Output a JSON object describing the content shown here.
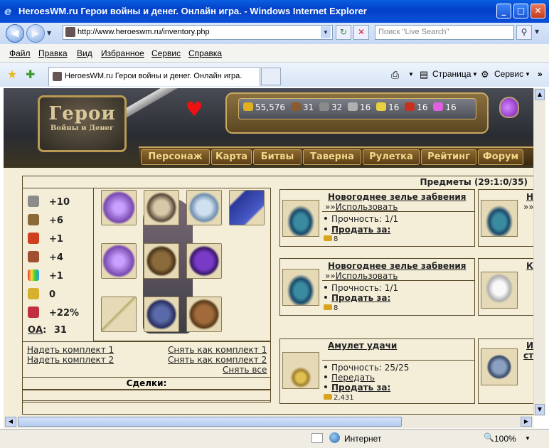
{
  "window": {
    "title": "HeroesWM.ru Герои войны и денег. Онлайн игра. - Windows Internet Explorer"
  },
  "browser": {
    "url": "http://www.heroeswm.ru/inventory.php",
    "search_placeholder": "Поиск \"Live Search\"",
    "menu": [
      "Файл",
      "Правка",
      "Вид",
      "Избранное",
      "Сервис",
      "Справка"
    ],
    "tab_title": "HeroesWM.ru Герои войны и денег. Онлайн игра.",
    "tools": {
      "page": "Страница",
      "service": "Сервис"
    },
    "status": {
      "zone": "Интернет",
      "zoom": "100%"
    }
  },
  "game": {
    "logo": {
      "title": "Герои",
      "subtitle": "Войны и Денег"
    },
    "resources": [
      {
        "name": "gold",
        "value": "55,576",
        "color": "#e0b020"
      },
      {
        "name": "wood",
        "value": "31",
        "color": "#8a5a30"
      },
      {
        "name": "ore",
        "value": "32",
        "color": "#8a8a8a"
      },
      {
        "name": "mercury",
        "value": "16",
        "color": "#b0b0b0"
      },
      {
        "name": "sulfur",
        "value": "16",
        "color": "#e8d040"
      },
      {
        "name": "crystals",
        "value": "16",
        "color": "#c83020"
      },
      {
        "name": "gems",
        "value": "16",
        "color": "#e060e0"
      }
    ],
    "nav": [
      "Персонаж",
      "Карта",
      "Битвы",
      "Таверна",
      "Рулетка",
      "Рейтинг",
      "Форум"
    ],
    "items_header": "Предметы (29:1:0/35)",
    "stats": [
      {
        "icon": "attack-icon",
        "value": "+10",
        "color": "#8b8b8b"
      },
      {
        "icon": "defense-icon",
        "value": "+6",
        "color": "#8b6a3a"
      },
      {
        "icon": "spellpower-icon",
        "value": "+1",
        "color": "#d04020"
      },
      {
        "icon": "knowledge-icon",
        "value": "+4",
        "color": "#a05030"
      },
      {
        "icon": "luck-icon",
        "value": "+1",
        "color": "#40a040"
      },
      {
        "icon": "morale-icon",
        "value": "0",
        "color": "#d8b030"
      },
      {
        "icon": "initiative-icon",
        "value": "+22%",
        "color": "#c03040"
      }
    ],
    "oa": {
      "label": "ОА",
      "value": "31"
    },
    "equip_links": {
      "wear1": "Надеть комплект 1",
      "wear2": "Надеть комплект 2",
      "save1": "Снять как комплект 1",
      "save2": "Снять как комплект 2",
      "remove_all": "Снять все"
    },
    "deals": "Сделки:",
    "items": [
      {
        "title": "Новогоднее зелье забвения",
        "action": "Использовать",
        "durability": "Прочность: 1/1",
        "sell": "Продать за:",
        "price": "8"
      },
      {
        "title": "Новогоднее зелье забвения",
        "action": "Использовать",
        "durability": "Прочность: 1/1",
        "sell": "Продать за:",
        "price": "8"
      },
      {
        "title": "Амулет удачи",
        "durability": "Прочность: 25/25",
        "transfer": "Передать",
        "sell": "Продать за:",
        "price": "2,431"
      }
    ],
    "items_right": [
      {
        "title": "Н",
        "action": "»»"
      },
      {
        "title": "К"
      },
      {
        "title": "И",
        "title2": "ст"
      }
    ],
    "action_prefix": "»»"
  }
}
